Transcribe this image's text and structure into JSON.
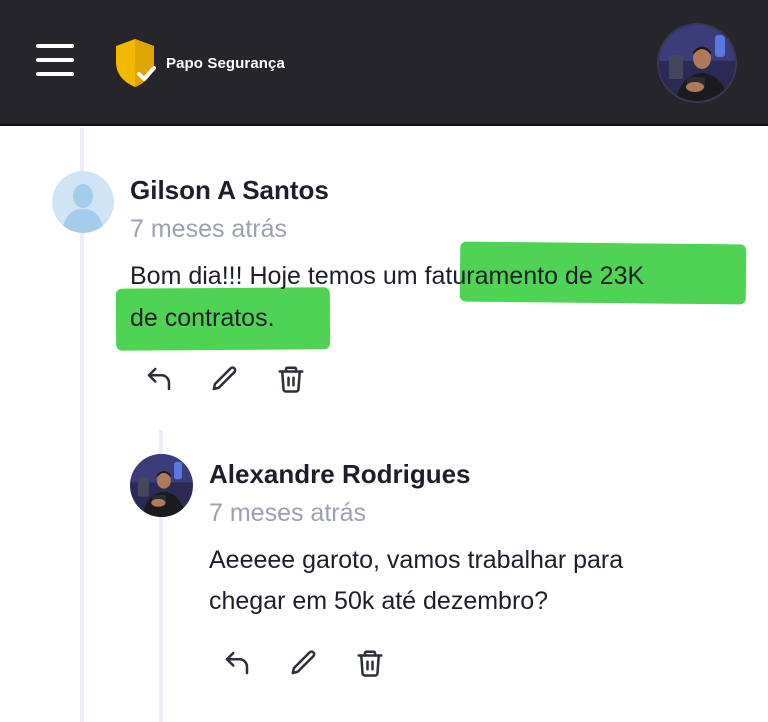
{
  "header": {
    "brand_name": "Papo Segurança",
    "menu_icon": "hamburger-menu-icon",
    "logo_icon": "shield-check-icon",
    "brand_color": "#F5B800",
    "background": "#262529"
  },
  "comment": {
    "author": "Gilson A Santos",
    "time": "7 meses atrás",
    "text_lines": [
      "Bom dia!!! Hoje temos um faturamento de 23K",
      "de contratos."
    ],
    "highlight_color": "#4FD354",
    "actions": [
      "reply-icon",
      "edit-icon",
      "delete-icon"
    ]
  },
  "reply": {
    "author": "Alexandre Rodrigues",
    "time": "7 meses atrás",
    "text_lines": [
      "Aeeeee garoto, vamos trabalhar para",
      "chegar em 50k até dezembro?"
    ],
    "actions": [
      "reply-icon",
      "edit-icon",
      "delete-icon"
    ]
  }
}
